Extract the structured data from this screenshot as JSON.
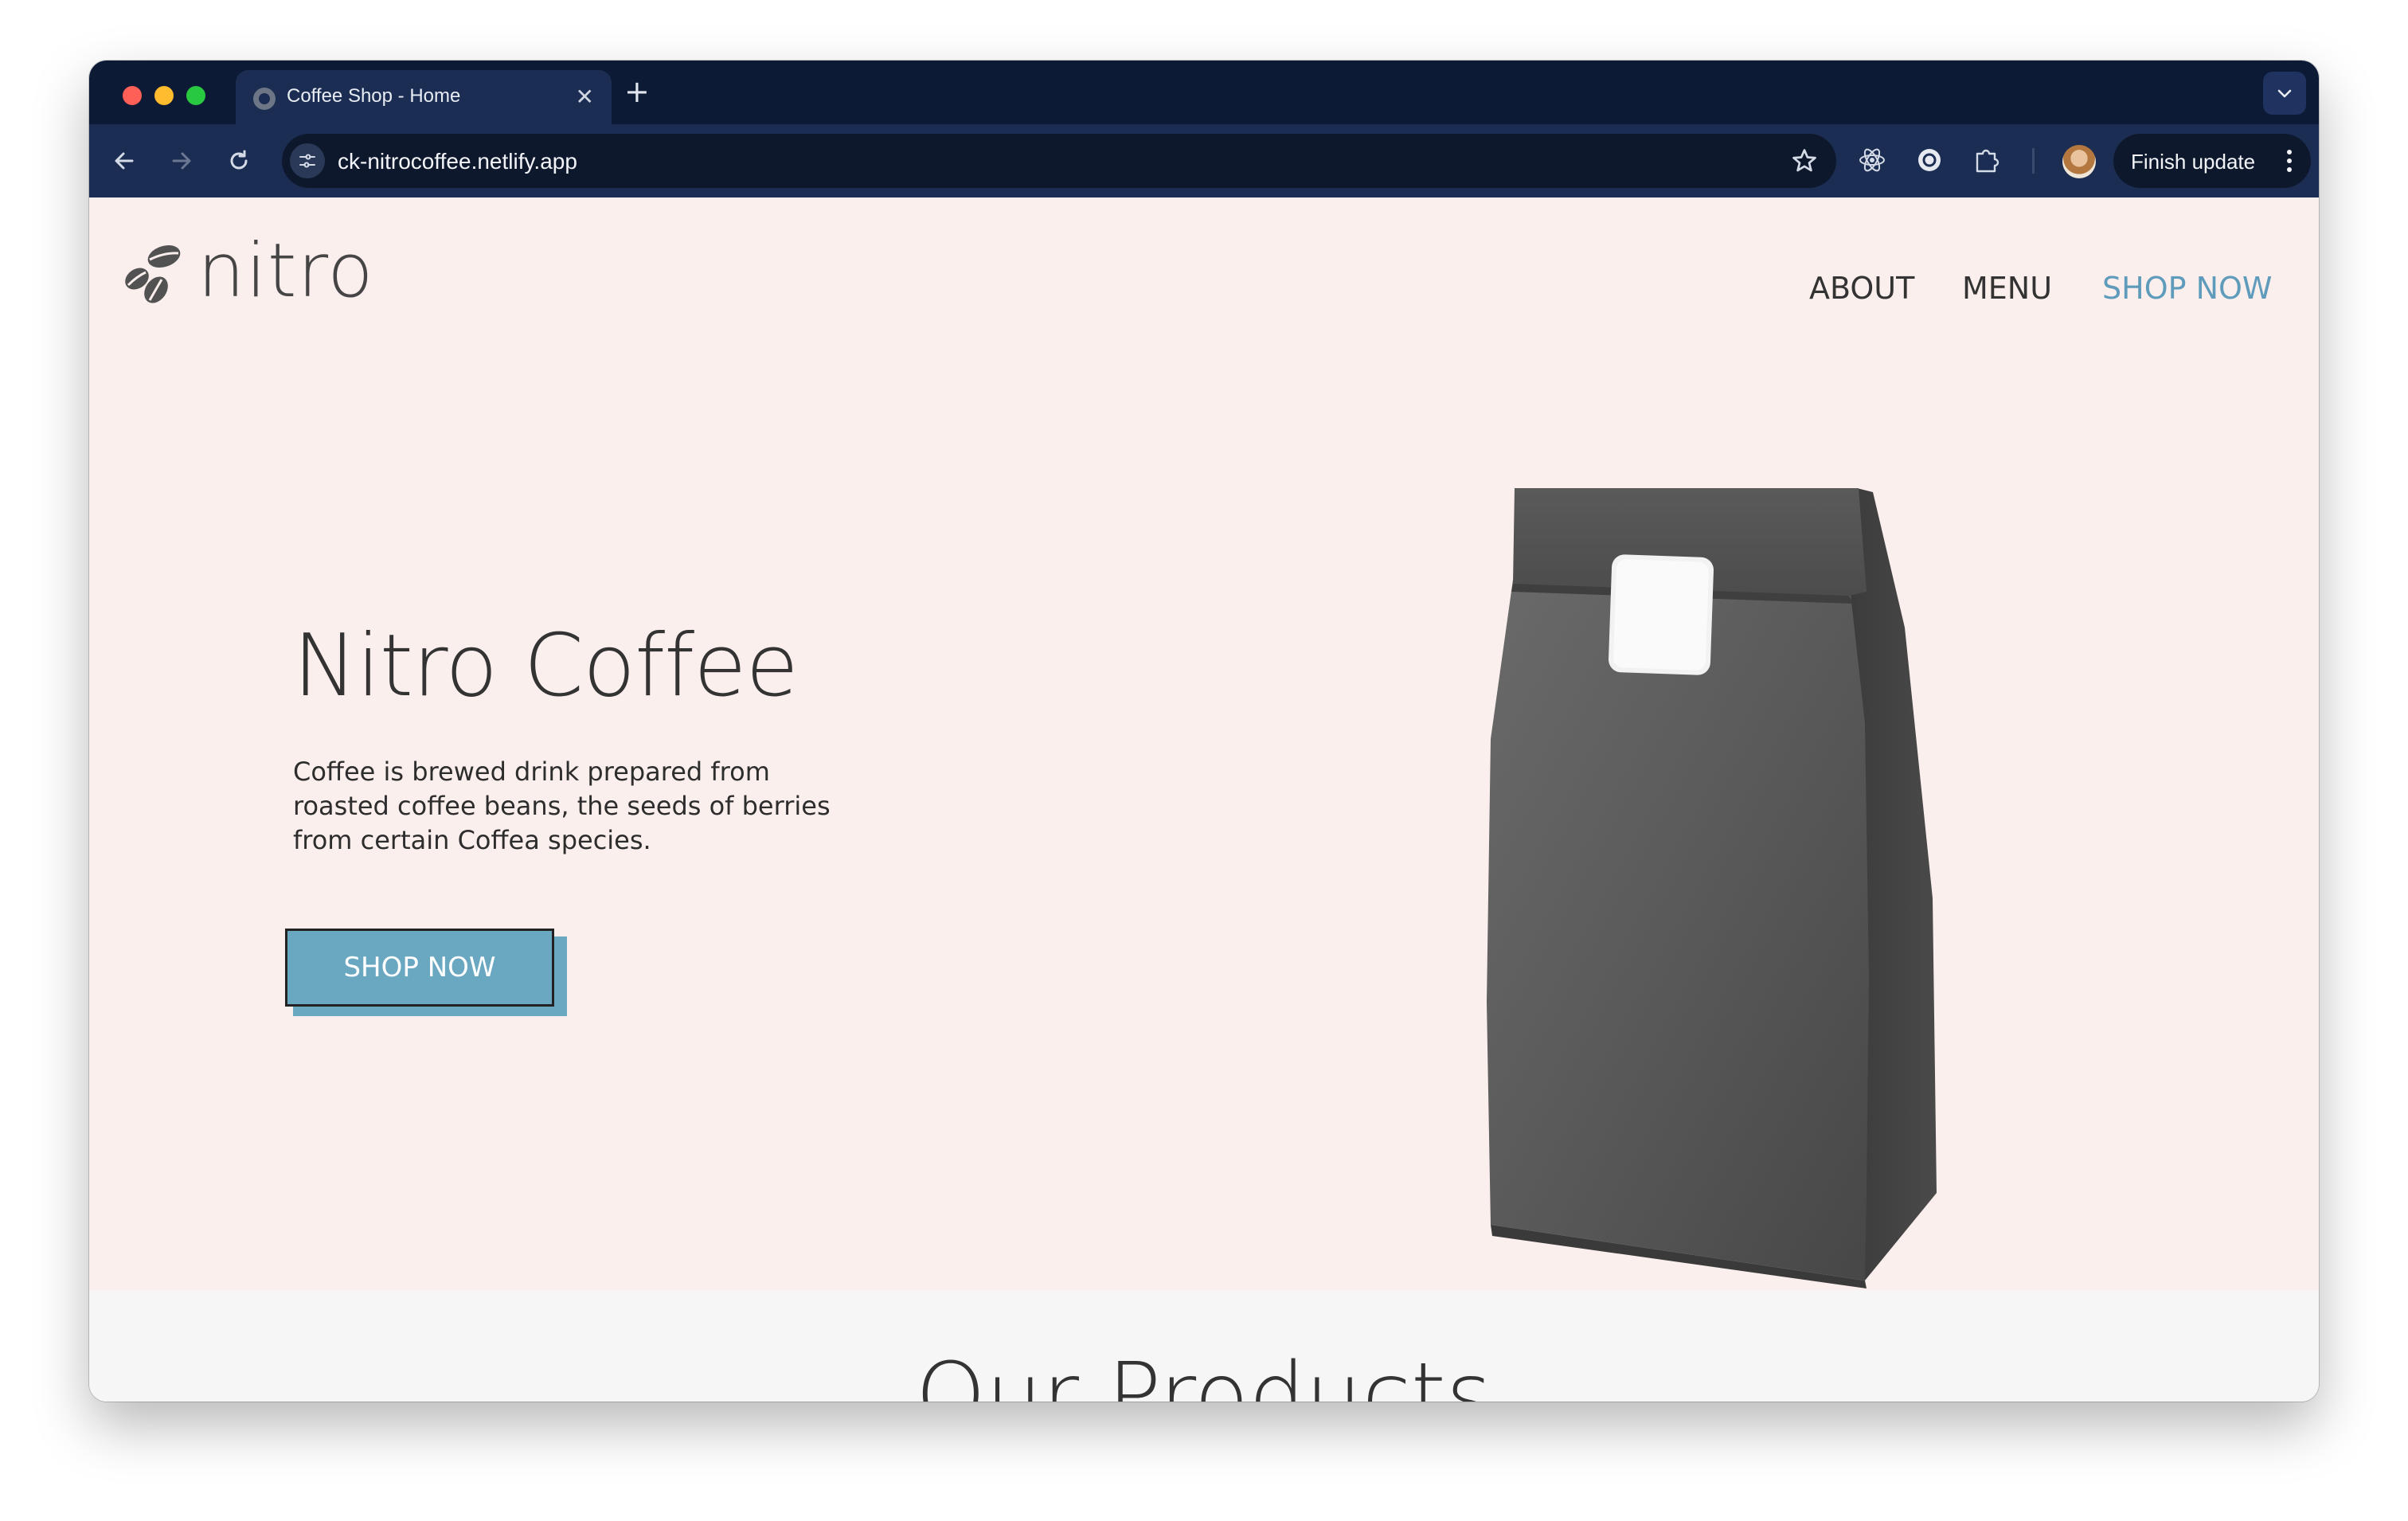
{
  "browser": {
    "tab_title": "Coffee Shop - Home",
    "new_tab_label": "+",
    "url": "ck-nitrocoffee.netlify.app",
    "finish_update_label": "Finish update",
    "icons": [
      "back-icon",
      "forward-icon",
      "reload-icon",
      "site-info-icon",
      "star-icon",
      "react-devtools-icon",
      "extension-circle-icon",
      "extensions-puzzle-icon",
      "profile-avatar",
      "more-vert-icon",
      "tab-search-icon",
      "close-icon"
    ]
  },
  "site": {
    "logo_text": "nitro",
    "nav": [
      {
        "label": "ABOUT"
      },
      {
        "label": "MENU"
      },
      {
        "label": "SHOP NOW",
        "active_color": "#5f9cbc"
      }
    ],
    "hero": {
      "title": "Nitro Coffee",
      "description": "Coffee is brewed drink prepared from roasted coffee beans, the seeds of berries from certain Coffea species.",
      "cta_label": "SHOP NOW",
      "cta_color": "#6aa7c0",
      "background": "#fbefed"
    },
    "products_heading": "Our Products"
  }
}
